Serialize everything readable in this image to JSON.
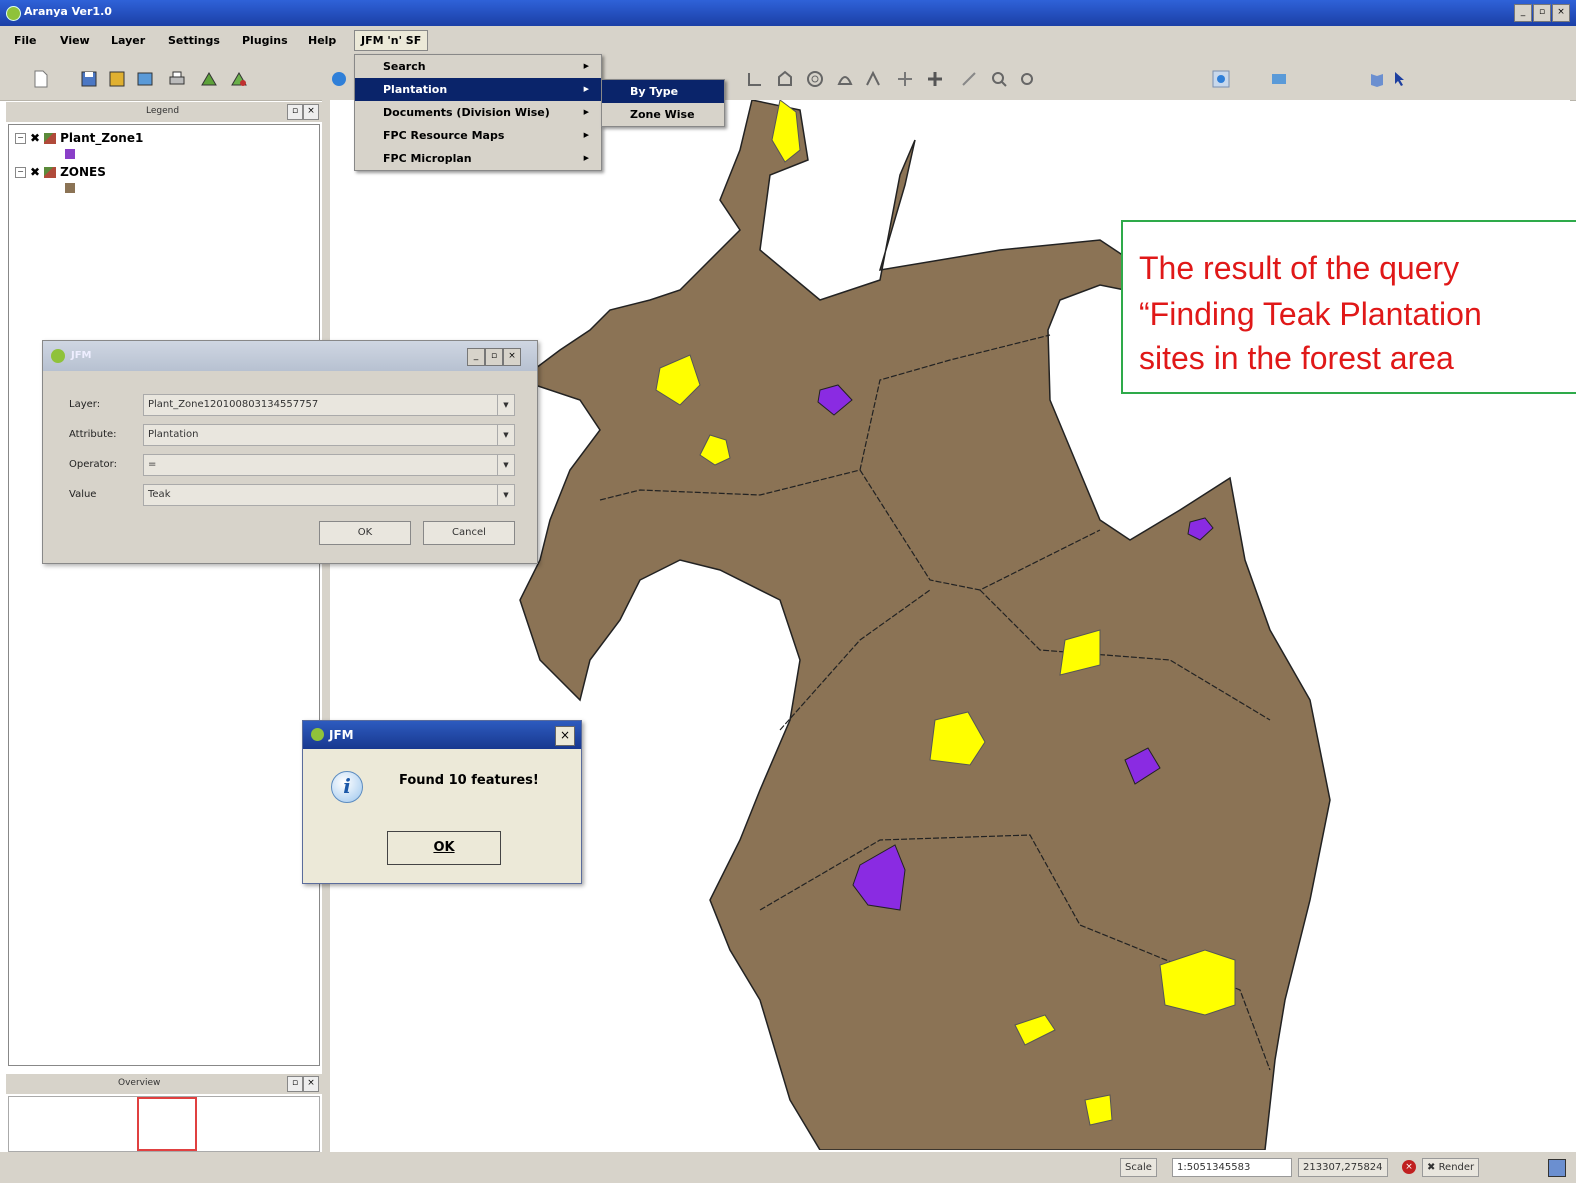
{
  "window": {
    "title": "Aranya Ver1.0",
    "controls": [
      "_",
      "▫",
      "×"
    ]
  },
  "menubar": {
    "items": [
      "File",
      "View",
      "Layer",
      "Settings",
      "Plugins",
      "Help",
      "JFM 'n' SF"
    ]
  },
  "jfm_menu": {
    "items": [
      {
        "label": "Search"
      },
      {
        "label": "Plantation"
      },
      {
        "label": "Documents (Division Wise)"
      },
      {
        "label": "FPC Resource Maps"
      },
      {
        "label": "FPC Microplan"
      }
    ],
    "submenu": [
      "By Type",
      "Zone Wise"
    ]
  },
  "legend": {
    "title": "Legend",
    "layers": [
      {
        "name": "Plant_Zone1",
        "swatch": "#8a3fc8"
      },
      {
        "name": "ZONES",
        "swatch": "#8b7355"
      }
    ]
  },
  "overview": {
    "title": "Overview"
  },
  "query_dialog": {
    "title": "JFM",
    "fields": [
      {
        "label": "Layer:",
        "value": "Plant_Zone120100803134557757"
      },
      {
        "label": "Attribute:",
        "value": "Plantation"
      },
      {
        "label": "Operator:",
        "value": "="
      },
      {
        "label": "Value",
        "value": "Teak"
      }
    ],
    "ok": "OK",
    "cancel": "Cancel"
  },
  "result_dialog": {
    "title": "JFM",
    "message": "Found 10 features!",
    "ok": "OK"
  },
  "annotation": {
    "lines": [
      "The result of the query",
      "“Finding Teak Plantation",
      "sites in the forest area"
    ],
    "text_color": "#e01818",
    "border_color": "#2eaa4a"
  },
  "statusbar": {
    "scale_label": "Scale",
    "scale": "1:5051345583",
    "coords": "213307,275824",
    "render": "Render"
  },
  "colors": {
    "zone_fill": "#8b7355",
    "teak_fill": "#ffff00",
    "other_fill": "#8a2be2"
  }
}
